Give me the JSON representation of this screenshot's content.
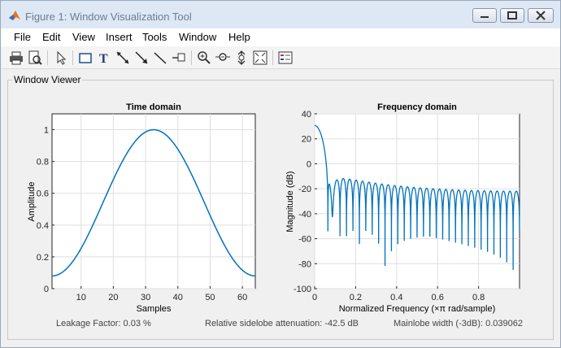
{
  "window": {
    "title": "Figure 1: Window Visualization Tool"
  },
  "menu": [
    "File",
    "Edit",
    "View",
    "Insert",
    "Tools",
    "Window",
    "Help"
  ],
  "toolbar_icons": [
    "print-icon",
    "print-preview-icon",
    "select-arrow-icon",
    "rectangle-icon",
    "text-icon",
    "double-arrow-icon",
    "arrow-icon",
    "line-icon",
    "pin-icon",
    "zoom-in-icon",
    "zoom-out-icon",
    "pan-icon",
    "fit-icon",
    "legend-icon"
  ],
  "viewer": {
    "title": "Window Viewer"
  },
  "time_plot": {
    "title": "Time domain",
    "xlabel": "Samples",
    "ylabel": "Amplitude",
    "xticks": [
      "10",
      "20",
      "30",
      "40",
      "50",
      "60"
    ],
    "yticks": [
      "0",
      "0.2",
      "0.4",
      "0.6",
      "0.8",
      "1"
    ]
  },
  "freq_plot": {
    "title": "Frequency domain",
    "xlabel": "Normalized Frequency  (×π rad/sample)",
    "ylabel": "Magnitude (dB)",
    "xticks": [
      "0",
      "0.2",
      "0.4",
      "0.6",
      "0.8"
    ],
    "yticks": [
      "40",
      "20",
      "0",
      "-20",
      "-40",
      "-60",
      "-80",
      "-100"
    ]
  },
  "status": {
    "leakage": "Leakage Factor: 0.03 %",
    "sidelobe": "Relative sidelobe attenuation: -42.5 dB",
    "mainlobe": "Mainlobe width (-3dB): 0.039062"
  },
  "colors": {
    "line": "#0072bd",
    "title_bar": "#dde8f4"
  },
  "chart_data": [
    {
      "type": "line",
      "title": "Time domain",
      "xlabel": "Samples",
      "ylabel": "Amplitude",
      "xlim": [
        1,
        64
      ],
      "ylim": [
        0,
        1.1
      ],
      "grid": true,
      "series": [
        {
          "x_range": [
            1,
            64
          ],
          "values_description_points": [
            [
              1,
              0.08
            ],
            [
              10,
              0.25
            ],
            [
              20,
              0.67
            ],
            [
              32.5,
              1.0
            ],
            [
              45,
              0.67
            ],
            [
              55,
              0.25
            ],
            [
              64,
              0.08
            ]
          ]
        }
      ]
    },
    {
      "type": "line",
      "title": "Frequency domain",
      "xlabel": "Normalized Frequency  (×π rad/sample)",
      "ylabel": "Magnitude (dB)",
      "xlim": [
        0,
        1
      ],
      "ylim": [
        -100,
        40
      ],
      "grid": true,
      "series": [
        {
          "mainlobe_peak_db": 30.1,
          "first_null_x": 0.065,
          "sidelobe_level_db": -12.4,
          "sidelobe_level_end_db": -22,
          "nulls_end_db": -85
        }
      ]
    }
  ]
}
